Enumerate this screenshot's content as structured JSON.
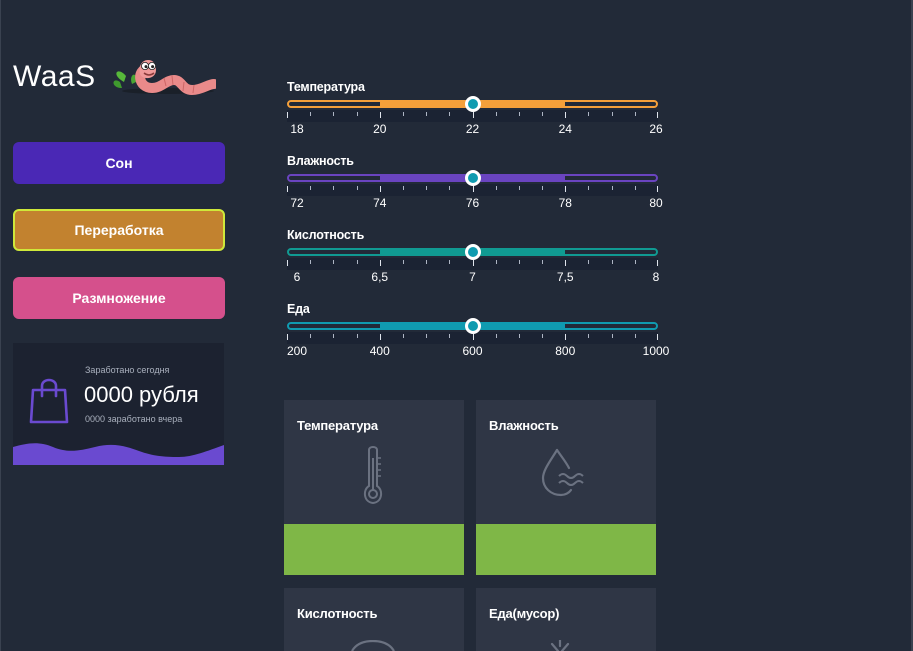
{
  "app": {
    "title": "WaaS"
  },
  "modes": [
    {
      "label": "Сон",
      "color": "#4a28b5"
    },
    {
      "label": "Переработка",
      "color": "#c2822f",
      "active_border": "#cfe83a"
    },
    {
      "label": "Размножение",
      "color": "#d5508c"
    }
  ],
  "earnings": {
    "today_label": "Заработано сегодня",
    "amount": "0000 рубля",
    "yesterday": "0000 заработано вчера"
  },
  "sliders": [
    {
      "label": "Температура",
      "ticks": [
        "18",
        "20",
        "22",
        "24",
        "26"
      ],
      "min": 18,
      "max": 26,
      "value": 22,
      "range": [
        20,
        24
      ],
      "color": "#f5a03a"
    },
    {
      "label": "Влажность",
      "ticks": [
        "72",
        "74",
        "76",
        "78",
        "80"
      ],
      "min": 72,
      "max": 80,
      "value": 76,
      "range": [
        74,
        78
      ],
      "color": "#6a44c0"
    },
    {
      "label": "Кислотность",
      "ticks": [
        "6",
        "6,5",
        "7",
        "7,5",
        "8"
      ],
      "min": 6,
      "max": 8,
      "value": 7,
      "range": [
        6.5,
        7.5
      ],
      "color": "#109a92"
    },
    {
      "label": "Еда",
      "ticks": [
        "200",
        "400",
        "600",
        "800",
        "1000"
      ],
      "min": 200,
      "max": 1000,
      "value": 600,
      "range": [
        400,
        800
      ],
      "color": "#109bb0"
    }
  ],
  "panels": [
    {
      "title": "Температура",
      "icon": "thermometer-icon",
      "status_color": "#7fb747"
    },
    {
      "title": "Влажность",
      "icon": "water-drop-icon",
      "status_color": "#7fb747"
    },
    {
      "title": "Кислотность",
      "icon": "ph-gauge-icon"
    },
    {
      "title": "Еда(мусор)",
      "icon": "food-icon"
    }
  ]
}
